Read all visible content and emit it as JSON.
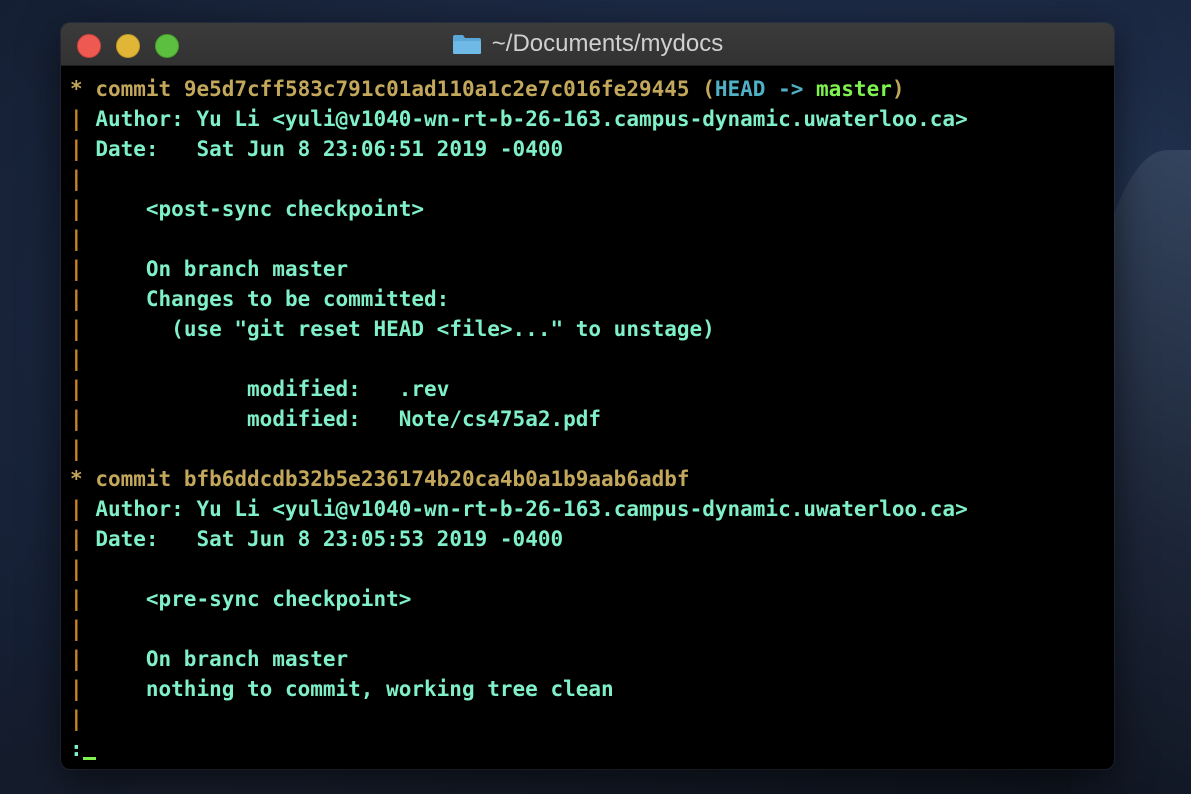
{
  "window": {
    "title": "~/Documents/mydocs",
    "folder_icon": "folder-icon"
  },
  "colors": {
    "text": "#7ff0c8",
    "commit": "#c3a85c",
    "graph": "#c98528",
    "head": "#4fb0c6",
    "branch": "#7ff24f"
  },
  "commits": [
    {
      "star": "*",
      "label": "commit 9e5d7cff583c791c01ad110a1c2e7c016fe29445",
      "ref_open": " (",
      "head": "HEAD",
      "arrow": " -> ",
      "branch": "master",
      "ref_close": ")",
      "author_key": "Author:",
      "author": "Yu Li <yuli@v1040-wn-rt-b-26-163.campus-dynamic.uwaterloo.ca>",
      "date_key": "Date:",
      "date": "Sat Jun 8 23:06:51 2019 -0400",
      "message": "<post-sync checkpoint>",
      "status1": "On branch master",
      "status2": "Changes to be committed:",
      "hint": "(use \"git reset HEAD <file>...\" to unstage)",
      "files": [
        {
          "state": "modified:",
          "path": ".rev"
        },
        {
          "state": "modified:",
          "path": "Note/cs475a2.pdf"
        }
      ]
    },
    {
      "star": "*",
      "label": "commit bfb6ddcdb32b5e236174b20ca4b0a1b9aab6adbf",
      "author_key": "Author:",
      "author": "Yu Li <yuli@v1040-wn-rt-b-26-163.campus-dynamic.uwaterloo.ca>",
      "date_key": "Date:",
      "date": "Sat Jun 8 23:05:53 2019 -0400",
      "message": "<pre-sync checkpoint>",
      "status1": "On branch master",
      "status2": "nothing to commit, working tree clean"
    }
  ],
  "graph_char": "|",
  "prompt": ":"
}
